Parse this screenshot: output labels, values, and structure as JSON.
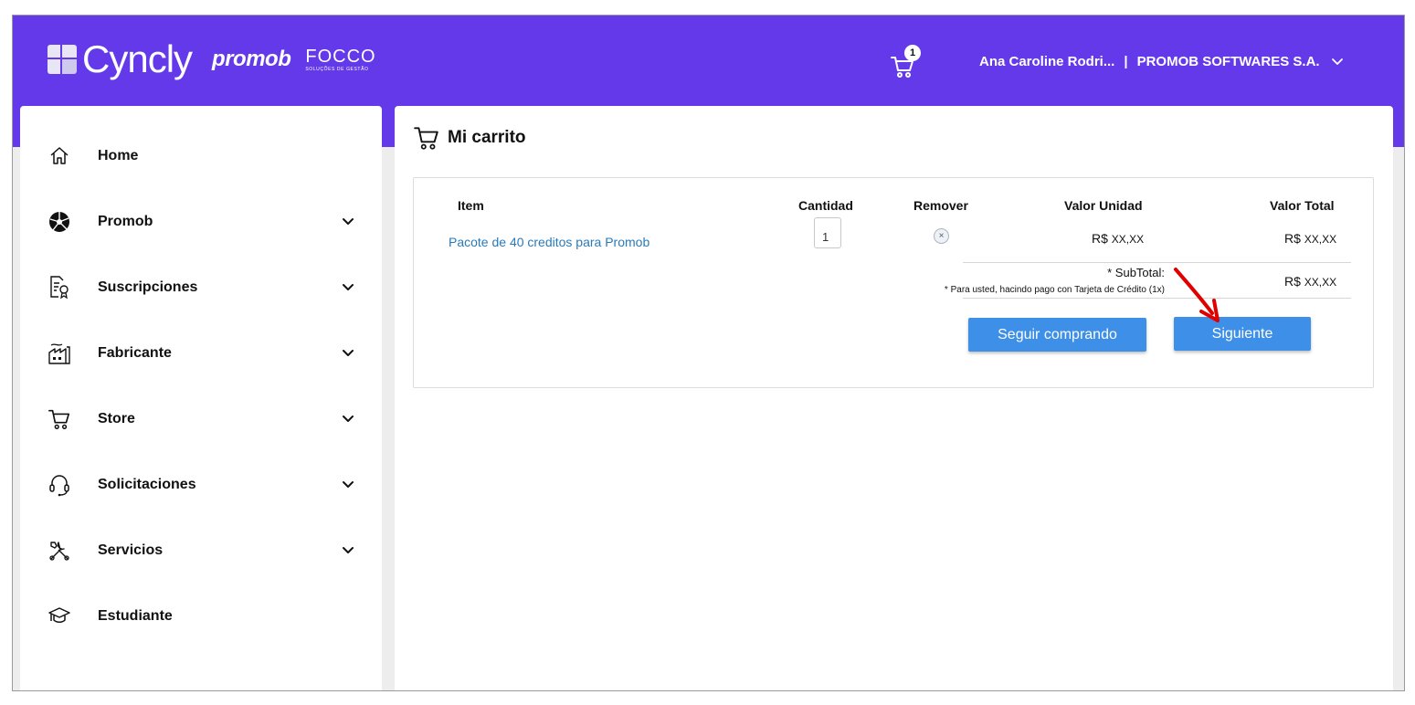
{
  "brand": {
    "cyncly": "Cyncly",
    "promob": "promob",
    "focco": "FOCCO",
    "focco_sub": "SOLUÇÕES DE GESTÃO"
  },
  "header": {
    "cart_count": "1",
    "user_name": "Ana Caroline Rodri...",
    "separator": "|",
    "company": "PROMOB SOFTWARES S.A."
  },
  "sidebar": {
    "items": [
      {
        "label": "Home",
        "icon": "home-icon",
        "has_chevron": false
      },
      {
        "label": "Promob",
        "icon": "promob-logo-icon",
        "has_chevron": true
      },
      {
        "label": "Suscripciones",
        "icon": "certificate-icon",
        "has_chevron": true
      },
      {
        "label": "Fabricante",
        "icon": "factory-icon",
        "has_chevron": true
      },
      {
        "label": "Store",
        "icon": "cart-icon",
        "has_chevron": true
      },
      {
        "label": "Solicitaciones",
        "icon": "headset-icon",
        "has_chevron": true
      },
      {
        "label": "Servicios",
        "icon": "tools-icon",
        "has_chevron": true
      },
      {
        "label": "Estudiante",
        "icon": "graduation-cap-icon",
        "has_chevron": false
      }
    ]
  },
  "cart": {
    "title": "Mi carrito",
    "columns": {
      "item": "Item",
      "quantity": "Cantidad",
      "remove": "Remover",
      "unit_value": "Valor Unidad",
      "total_value": "Valor Total"
    },
    "line": {
      "name": "Pacote de 40 creditos para Promob",
      "quantity": "1",
      "remove_symbol": "×",
      "currency": "R$",
      "unit_value": "XX,XX",
      "total_value": "XX,XX"
    },
    "subtotal": {
      "label": "* SubTotal:",
      "note": "* Para usted, hacindo pago con Tarjeta de Crédito (1x)",
      "currency": "R$",
      "value": "XX,XX"
    },
    "buttons": {
      "continue": "Seguir comprando",
      "next": "Siguiente"
    }
  },
  "colors": {
    "header_bg": "#6439EA",
    "button_bg": "#3D8FE8",
    "link": "#2a7ab8",
    "annotation_arrow": "#e00000"
  }
}
